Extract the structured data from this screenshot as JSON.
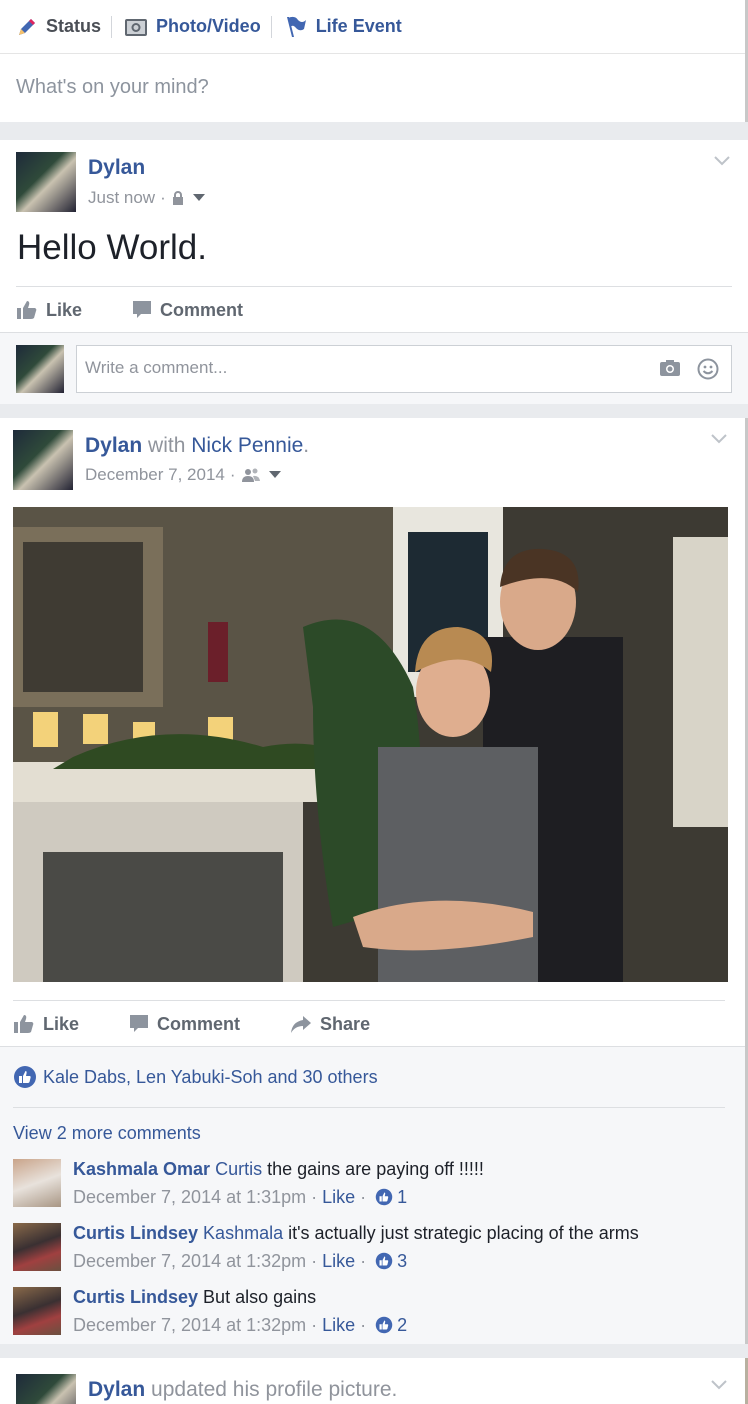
{
  "composer": {
    "tabs": [
      {
        "label": "Status"
      },
      {
        "label": "Photo/Video"
      },
      {
        "label": "Life Event"
      }
    ],
    "placeholder": "What's on your mind?"
  },
  "post1": {
    "author": "Dylan",
    "time": "Just now",
    "text": "Hello World.",
    "actions": {
      "like": "Like",
      "comment": "Comment"
    },
    "comment_placeholder": "Write a comment..."
  },
  "post2": {
    "author": "Dylan",
    "with_word": "with",
    "tagged": "Nick Pennie",
    "date": "December 7, 2014",
    "actions": {
      "like": "Like",
      "comment": "Comment",
      "share": "Share"
    },
    "likes_text": "Kale Dabs, Len Yabuki-Soh and 30 others",
    "view_more": "View 2 more comments",
    "comments": [
      {
        "name": "Kashmala Omar",
        "mention": "Curtis",
        "text": "the gains are paying off !!!!!",
        "time": "December 7, 2014 at 1:31pm",
        "like": "Like",
        "count": "1"
      },
      {
        "name": "Curtis Lindsey",
        "mention": "Kashmala",
        "text": "it's actually just strategic placing of the arms",
        "time": "December 7, 2014 at 1:32pm",
        "like": "Like",
        "count": "3"
      },
      {
        "name": "Curtis Lindsey",
        "mention": "",
        "text": "But also gains",
        "time": "December 7, 2014 at 1:32pm",
        "like": "Like",
        "count": "2"
      }
    ]
  },
  "post3": {
    "author": "Dylan",
    "text": "updated his profile picture."
  },
  "colors": {
    "link": "#365899",
    "muted": "#90949c",
    "like_blue": "#4267b2"
  }
}
